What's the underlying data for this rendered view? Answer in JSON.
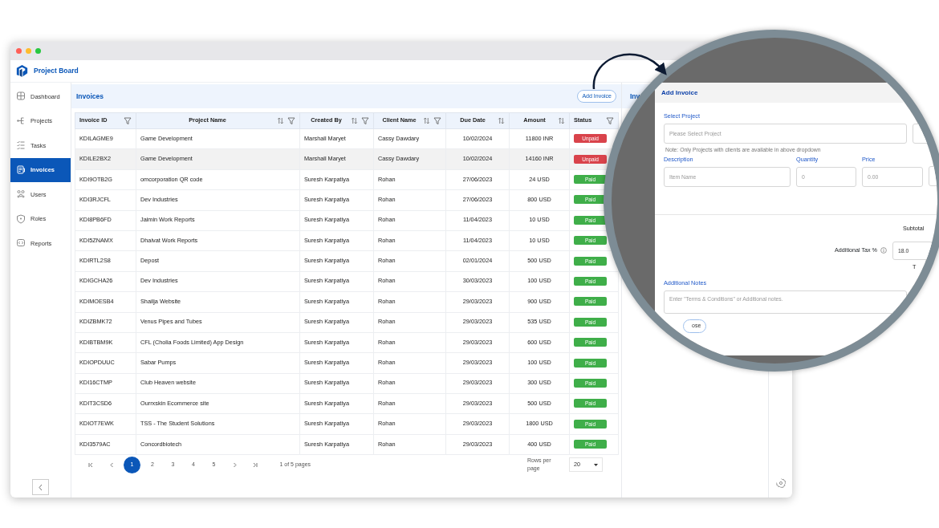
{
  "app": {
    "title": "Project Board"
  },
  "sidebar": {
    "items": [
      {
        "label": "Dashboard",
        "selected": false
      },
      {
        "label": "Projects",
        "selected": false
      },
      {
        "label": "Tasks",
        "selected": false
      },
      {
        "label": "Invoices",
        "selected": true
      },
      {
        "label": "Users",
        "selected": false
      },
      {
        "label": "Roles",
        "selected": false
      },
      {
        "label": "Reports",
        "selected": false
      }
    ]
  },
  "page": {
    "title": "Invoices",
    "add_button": "Add Invoice",
    "side_title": "Inv"
  },
  "table": {
    "columns": [
      {
        "label": "Invoice ID",
        "sortable": false,
        "filterable": true
      },
      {
        "label": "Project Name",
        "sortable": true,
        "filterable": true
      },
      {
        "label": "Created By",
        "sortable": true,
        "filterable": true
      },
      {
        "label": "Client Name",
        "sortable": true,
        "filterable": true
      },
      {
        "label": "Due Date",
        "sortable": true,
        "filterable": false
      },
      {
        "label": "Amount",
        "sortable": true,
        "filterable": false
      },
      {
        "label": "Status",
        "sortable": false,
        "filterable": true
      }
    ],
    "rows": [
      {
        "cells": [
          "KDILAGME9",
          "Game Development",
          "Marshall Maryet",
          "Cassy Dawdary",
          "10/02/2024",
          "11800 INR"
        ],
        "status": {
          "label": "Unpaid",
          "kind": "unpaid"
        },
        "selected": false
      },
      {
        "cells": [
          "KDILE2BX2",
          "Game Development",
          "Marshall Maryet",
          "Cassy Dawdary",
          "10/02/2024",
          "14160 INR"
        ],
        "status": {
          "label": "Unpaid",
          "kind": "unpaid"
        },
        "selected": true
      },
      {
        "cells": [
          "KDI9OTB2G",
          "omcorporation QR code",
          "Suresh Karpatiya",
          "Rohan",
          "27/06/2023",
          "24 USD"
        ],
        "status": {
          "label": "Paid",
          "kind": "paid"
        },
        "selected": false
      },
      {
        "cells": [
          "KDI3RJCFL",
          "Dev Industries",
          "Suresh Karpatiya",
          "Rohan",
          "27/06/2023",
          "800 USD"
        ],
        "status": {
          "label": "Paid",
          "kind": "paid"
        },
        "selected": false
      },
      {
        "cells": [
          "KDI8PB6FD",
          "Jaimin Work Reports",
          "Suresh Karpatiya",
          "Rohan",
          "11/04/2023",
          "10 USD"
        ],
        "status": {
          "label": "Paid",
          "kind": "paid"
        },
        "selected": false
      },
      {
        "cells": [
          "KDI5ZNAMX",
          "Dhaivat Work Reports",
          "Suresh Karpatiya",
          "Rohan",
          "11/04/2023",
          "10 USD"
        ],
        "status": {
          "label": "Paid",
          "kind": "paid"
        },
        "selected": false
      },
      {
        "cells": [
          "KDIRTL2S8",
          "Depost",
          "Suresh Karpatiya",
          "Rohan",
          "02/01/2024",
          "500 USD"
        ],
        "status": {
          "label": "Paid",
          "kind": "paid"
        },
        "selected": false
      },
      {
        "cells": [
          "KDIGCHA26",
          "Dev Industries",
          "Suresh Karpatiya",
          "Rohan",
          "30/03/2023",
          "100 USD"
        ],
        "status": {
          "label": "Paid",
          "kind": "paid"
        },
        "selected": false
      },
      {
        "cells": [
          "KDIMOESB4",
          "Shailja Website",
          "Suresh Karpatiya",
          "Rohan",
          "29/03/2023",
          "900 USD"
        ],
        "status": {
          "label": "Paid",
          "kind": "paid"
        },
        "selected": false
      },
      {
        "cells": [
          "KDIZBMK72",
          "Venus Pipes and Tubes",
          "Suresh Karpatiya",
          "Rohan",
          "29/03/2023",
          "535 USD"
        ],
        "status": {
          "label": "Paid",
          "kind": "paid"
        },
        "selected": false
      },
      {
        "cells": [
          "KDIBTBM9K",
          "CFL (Cholia Foods Limited) App Design",
          "Suresh Karpatiya",
          "Rohan",
          "29/03/2023",
          "600 USD"
        ],
        "status": {
          "label": "Paid",
          "kind": "paid"
        },
        "selected": false
      },
      {
        "cells": [
          "KDIOPDUUC",
          "Sabar Pumps",
          "Suresh Karpatiya",
          "Rohan",
          "29/03/2023",
          "100 USD"
        ],
        "status": {
          "label": "Paid",
          "kind": "paid"
        },
        "selected": false
      },
      {
        "cells": [
          "KDI16CTMP",
          "Club Heaven website",
          "Suresh Karpatiya",
          "Rohan",
          "29/03/2023",
          "300 USD"
        ],
        "status": {
          "label": "Paid",
          "kind": "paid"
        },
        "selected": false
      },
      {
        "cells": [
          "KDIT3CSD6",
          "Ourrxskin Ecommerce site",
          "Suresh Karpatiya",
          "Rohan",
          "29/03/2023",
          "500 USD"
        ],
        "status": {
          "label": "Paid",
          "kind": "paid"
        },
        "selected": false
      },
      {
        "cells": [
          "KDIOT7EWK",
          "TSS - The Student Solutions",
          "Suresh Karpatiya",
          "Rohan",
          "29/03/2023",
          "1800 USD"
        ],
        "status": {
          "label": "Paid",
          "kind": "paid"
        },
        "selected": false
      },
      {
        "cells": [
          "KDI3579AC",
          "Concordbiotech",
          "Suresh Karpatiya",
          "Rohan",
          "29/03/2023",
          "400 USD"
        ],
        "status": {
          "label": "Paid",
          "kind": "paid"
        },
        "selected": false
      }
    ]
  },
  "pagination": {
    "pages": [
      {
        "label": "1",
        "selected": true
      },
      {
        "label": "2",
        "selected": false
      },
      {
        "label": "3",
        "selected": false
      },
      {
        "label": "4",
        "selected": false
      },
      {
        "label": "5",
        "selected": false
      }
    ],
    "summary": "1 of 5 pages",
    "rows_label": "Rows per page",
    "rows_value": "20"
  },
  "modal": {
    "title": "Add Invoice",
    "project_label": "Select Project",
    "project_placeholder": "Please Select Project",
    "note": "Note: Only Projects with clients are available in above dropdown",
    "item_fields": [
      {
        "label": "Description",
        "placeholder": "Item Name"
      },
      {
        "label": "Quantity",
        "placeholder": "0"
      },
      {
        "label": "Price",
        "placeholder": "0.00"
      }
    ],
    "subtotal_label": "Subtotal",
    "tax_label": "Additional Tax %",
    "tax_value": "18.0",
    "total_label": "T",
    "notes_label": "Additional Notes",
    "notes_placeholder": "Enter \"Terms & Conditions\" or Additional notes.",
    "close_button": "ose"
  }
}
